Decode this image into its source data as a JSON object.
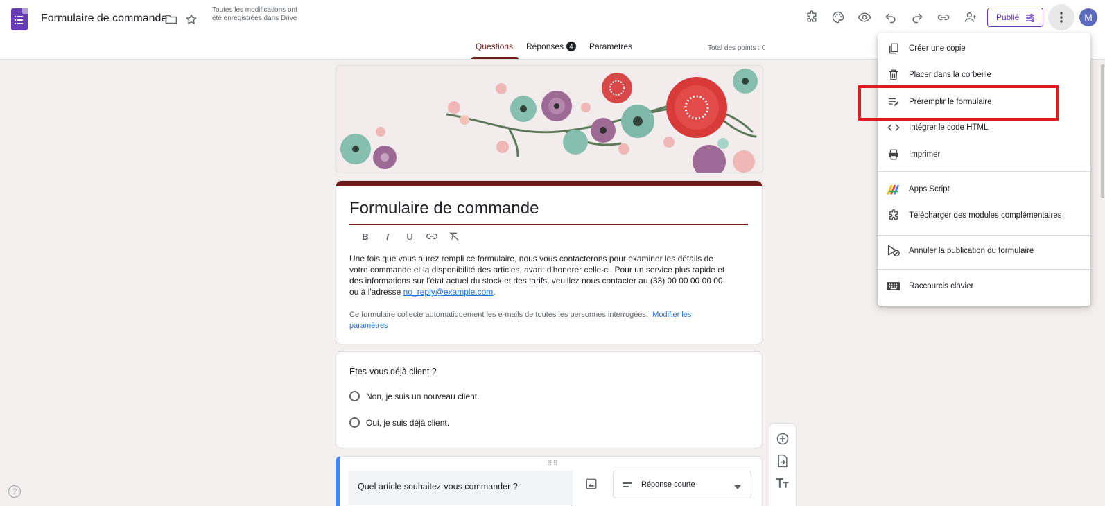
{
  "app": {
    "doc_title": "Formulaire de commande",
    "save_status": "Toutes les modifications ont été enregistrées dans Drive",
    "publish_label": "Publié",
    "avatar_letter": "M"
  },
  "tabs": [
    {
      "label": "Questions",
      "active": true
    },
    {
      "label": "Réponses",
      "badge": "4"
    },
    {
      "label": "Paramètres"
    }
  ],
  "points_total": "Total des points : 0",
  "form": {
    "title": "Formulaire de commande",
    "description_before_link": "Une fois que vous aurez rempli ce formulaire, nous vous contacterons pour examiner les détails de votre commande et la disponibilité des articles, avant d'honorer celle-ci. Pour un service plus rapide et des informations sur l'état actuel du stock et des tarifs, veuillez nous contacter au (33) 00 00 00 00 00 ou à l'adresse ",
    "description_link": "no_reply@example.com",
    "description_after_link": ".",
    "collect_notice": "Ce formulaire collecte automatiquement les e-mails de toutes les personnes interrogées.",
    "collect_link": "Modifier les paramètres"
  },
  "question1": {
    "title": "Êtes-vous déjà client ?",
    "options": [
      "Non, je suis un nouveau client.",
      "Oui, je suis déjà client."
    ]
  },
  "question2": {
    "title": "Quel article souhaitez-vous commander ?",
    "type": "Réponse courte"
  },
  "menu": {
    "items": [
      {
        "label": "Créer une copie",
        "icon": "copy-icon"
      },
      {
        "label": "Placer dans la corbeille",
        "icon": "trash-icon"
      },
      {
        "label": "Préremplir le formulaire",
        "icon": "prefill-icon",
        "highlighted": true
      },
      {
        "label": "Intégrer le code HTML",
        "icon": "code-icon"
      },
      {
        "label": "Imprimer",
        "icon": "print-icon"
      },
      {
        "label": "Apps Script",
        "icon": "apps-script-icon"
      },
      {
        "label": "Télécharger des modules complémentaires",
        "icon": "puzzle-icon"
      },
      {
        "label": "Annuler la publication du formulaire",
        "icon": "unpublish-icon"
      },
      {
        "label": "Raccourcis clavier",
        "icon": "keyboard-icon"
      }
    ]
  },
  "colors": {
    "accent": "#771d1d",
    "forms_purple": "#673ab7",
    "highlight_red": "#e01c1c",
    "link_blue": "#1a73e8"
  }
}
